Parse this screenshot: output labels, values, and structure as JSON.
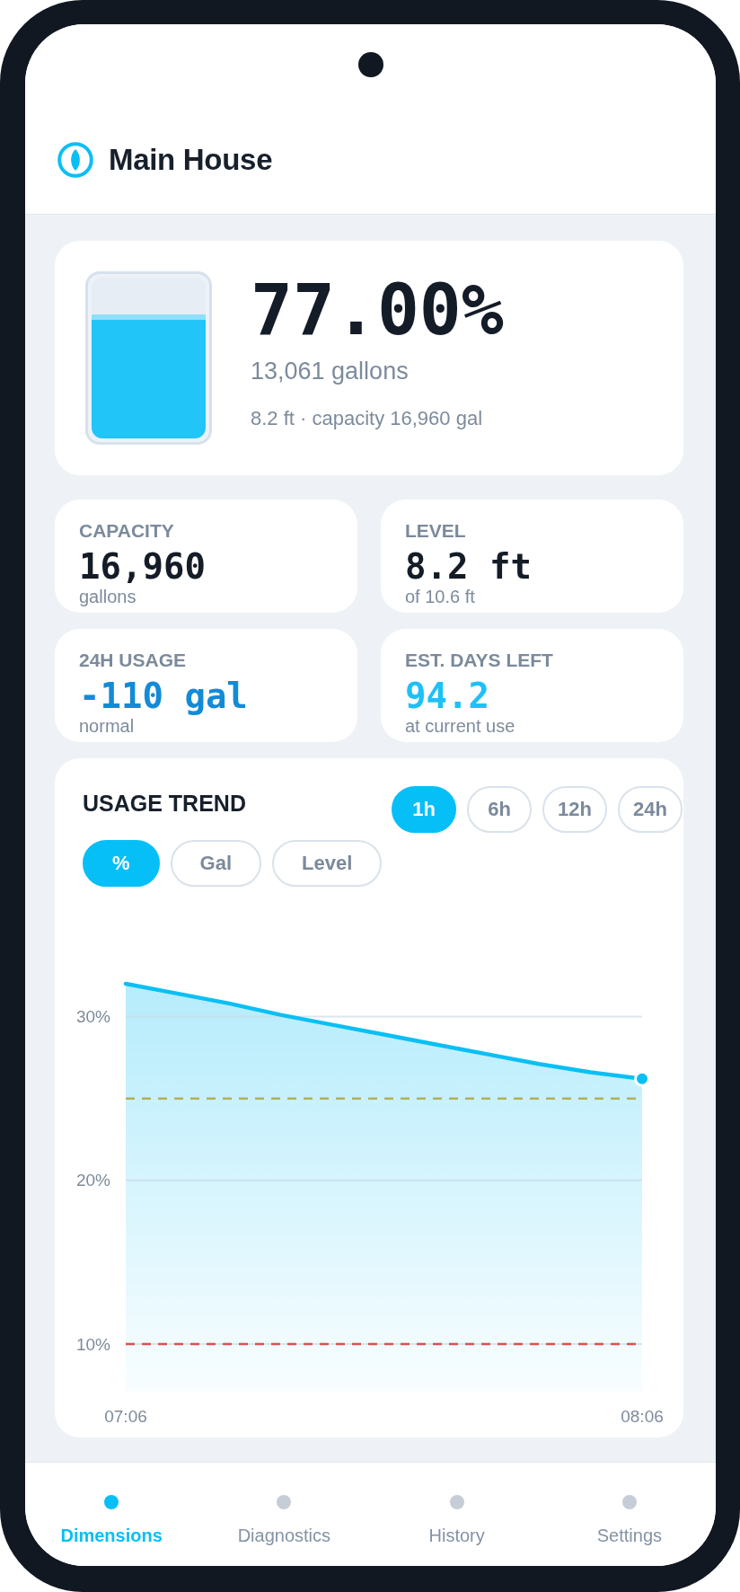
{
  "header": {
    "title": "Main House"
  },
  "tank": {
    "level": 0.77,
    "percent": "77.00%",
    "volume": "13,061 gallons",
    "details": "8.2 ft · capacity 16,960 gal"
  },
  "stats": [
    {
      "label": "CAPACITY",
      "value": "16,960",
      "note": "gallons",
      "color": "#141c27"
    },
    {
      "label": "LEVEL",
      "value": "8.2 ft",
      "note": "of 10.6 ft",
      "color": "#141c27"
    },
    {
      "label": "24H USAGE",
      "value": "-110 gal",
      "note": "normal",
      "color": "#138bd6"
    },
    {
      "label": "EST. DAYS LEFT",
      "value": "94.2",
      "note": "at current use",
      "color": "#1ec1f6"
    }
  ],
  "usage_trend": {
    "title": "USAGE TREND",
    "ranges": [
      {
        "label": "1h",
        "selected": true
      },
      {
        "label": "6h",
        "selected": false
      },
      {
        "label": "12h",
        "selected": false
      },
      {
        "label": "24h",
        "selected": false
      }
    ],
    "units": [
      {
        "label": "%",
        "selected": true
      },
      {
        "label": "Gal",
        "selected": false
      },
      {
        "label": "Level",
        "selected": false
      }
    ],
    "chart_data": {
      "type": "area",
      "categories": [
        "07:06",
        null,
        null,
        null,
        null,
        null,
        null,
        null,
        null,
        null,
        "08:06"
      ],
      "series": [
        {
          "color": "#0bbff4",
          "values": [
            32.0,
            31.4,
            30.8,
            30.1,
            29.5,
            28.9,
            28.3,
            27.7,
            27.1,
            26.6,
            26.2
          ]
        }
      ],
      "ylim": [
        7.1,
        32
      ],
      "yticks": [
        {
          "value": 10,
          "label": "10%"
        },
        {
          "value": 20,
          "label": "20%"
        },
        {
          "value": 30,
          "label": "30%"
        }
      ],
      "grid": true,
      "ref_lines": [
        {
          "axis": "y",
          "value": 25,
          "color": "#b3b05a"
        },
        {
          "axis": "y",
          "value": 10,
          "color": "#d9514f"
        }
      ]
    }
  },
  "nav": [
    {
      "label": "Dimensions",
      "selected": true
    },
    {
      "label": "Diagnostics",
      "selected": false
    },
    {
      "label": "History",
      "selected": false
    },
    {
      "label": "Settings",
      "selected": false
    }
  ]
}
